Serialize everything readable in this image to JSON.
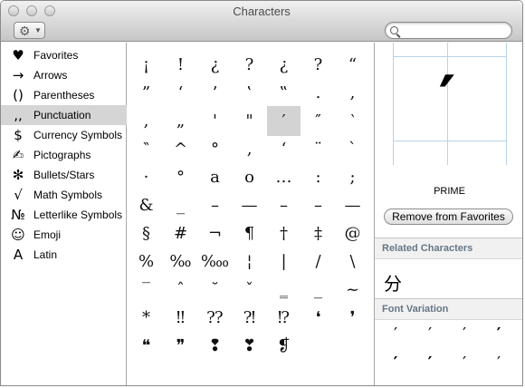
{
  "window": {
    "title": "Characters"
  },
  "toolbar": {
    "action_icon": "gear-icon",
    "search": {
      "value": "",
      "placeholder": ""
    }
  },
  "sidebar": {
    "items": [
      {
        "icon": "♥",
        "icon_name": "heart-icon",
        "label": "Favorites"
      },
      {
        "icon": "→",
        "icon_name": "arrow-icon",
        "label": "Arrows"
      },
      {
        "icon": "()",
        "icon_name": "parentheses-icon",
        "label": "Parentheses"
      },
      {
        "icon": ",,",
        "icon_name": "punctuation-icon",
        "label": "Punctuation"
      },
      {
        "icon": "$",
        "icon_name": "dollar-icon",
        "label": "Currency Symbols"
      },
      {
        "icon": "✍",
        "icon_name": "pictograph-icon",
        "label": "Pictographs"
      },
      {
        "icon": "✻",
        "icon_name": "asterisk-star-icon",
        "label": "Bullets/Stars"
      },
      {
        "icon": "√",
        "icon_name": "square-root-icon",
        "label": "Math Symbols"
      },
      {
        "icon": "№",
        "icon_name": "numero-icon",
        "label": "Letterlike Symbols"
      },
      {
        "icon": "☺",
        "icon_name": "smiley-icon",
        "label": "Emoji"
      },
      {
        "icon": "A",
        "icon_name": "latin-letter-icon",
        "label": "Latin"
      }
    ],
    "selected_index": 3
  },
  "grid": {
    "rows": [
      [
        "¡",
        "!",
        "¿",
        "?",
        "¿",
        "?",
        "“"
      ],
      [
        "”",
        "‘",
        "’",
        "‛",
        "‟",
        ".",
        ","
      ],
      [
        ",",
        "„",
        "'",
        "\"",
        "′",
        "″",
        "‵"
      ],
      [
        "‶",
        "^",
        "°",
        "‚",
        "‘",
        "¨",
        "`"
      ],
      [
        "·",
        "°",
        "a",
        "o",
        "…",
        ":",
        ";"
      ],
      [
        "&",
        "_",
        "–",
        "—",
        "–",
        "–",
        "—"
      ],
      [
        "§",
        "#",
        "¬",
        "¶",
        "†",
        "‡",
        "@"
      ],
      [
        "%",
        "‰",
        "‱",
        "¦",
        "|",
        "/",
        "\\"
      ],
      [
        "‾",
        "ˆ",
        "˘",
        "ˇ",
        "‗",
        "_",
        "~"
      ],
      [
        "*",
        "‼",
        "⁇",
        "⁈",
        "⁉",
        "❛",
        "❜"
      ],
      [
        "❝",
        "❞",
        "❢",
        "❣",
        "❡",
        "",
        ""
      ]
    ],
    "selected": {
      "row": 2,
      "col": 4
    }
  },
  "detail": {
    "preview_glyph": "′",
    "name": "PRIME",
    "remove_label": "Remove from Favorites",
    "related_heading": "Related Characters",
    "related_char": "分",
    "font_variation_heading": "Font Variation",
    "font_variations": [
      "′",
      "′",
      "′",
      "′",
      "′",
      "′",
      "′",
      "′"
    ]
  }
}
